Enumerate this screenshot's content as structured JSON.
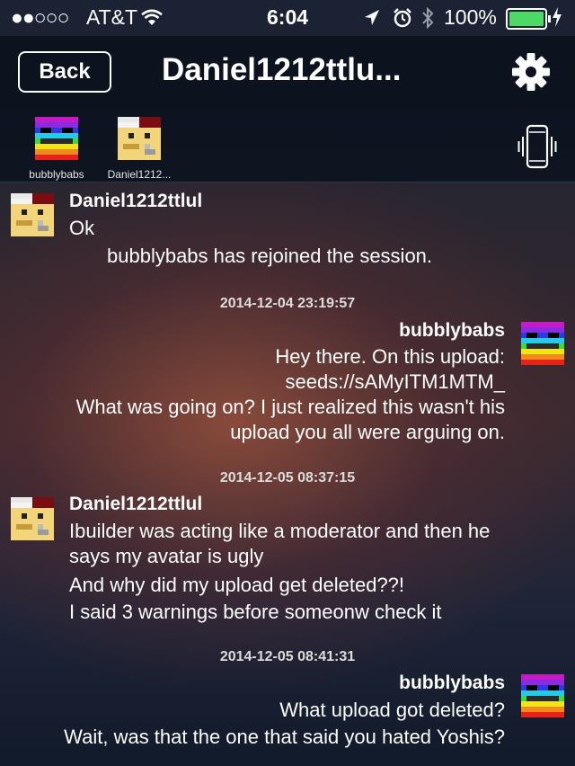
{
  "status_bar": {
    "signal": "●●○○○",
    "carrier": "AT&T",
    "time": "6:04",
    "battery_percent": "100%",
    "battery_level": 1.0
  },
  "nav": {
    "back_label": "Back",
    "title": "Daniel1212ttlu..."
  },
  "participants": [
    {
      "name": "bubblybabs"
    },
    {
      "name": "Daniel1212..."
    }
  ],
  "messages": {
    "m1": {
      "sender": "Daniel1212ttlul",
      "lines": [
        "Ok"
      ]
    },
    "system1": "bubblybabs has rejoined the session.",
    "ts1": "2014-12-04 23:19:57",
    "m2": {
      "sender": "bubblybabs",
      "lines": [
        "Hey there.  On this upload:",
        "seeds://sAMyITM1MTM_",
        "What was going on?  I just realized this wasn't his",
        "upload you all were arguing on."
      ]
    },
    "ts2": "2014-12-05 08:37:15",
    "m3": {
      "sender": "Daniel1212ttlul",
      "lines": [
        "Ibuilder was acting like a moderator and then he",
        "says my avatar is ugly",
        "And why did my upload get deleted??!",
        "I said 3 warnings before someonw check it"
      ]
    },
    "ts3": "2014-12-05 08:41:31",
    "m4": {
      "sender": "bubblybabs",
      "lines": [
        "What upload got deleted?",
        "Wait, was that the one that said you hated Yoshis?"
      ]
    }
  }
}
